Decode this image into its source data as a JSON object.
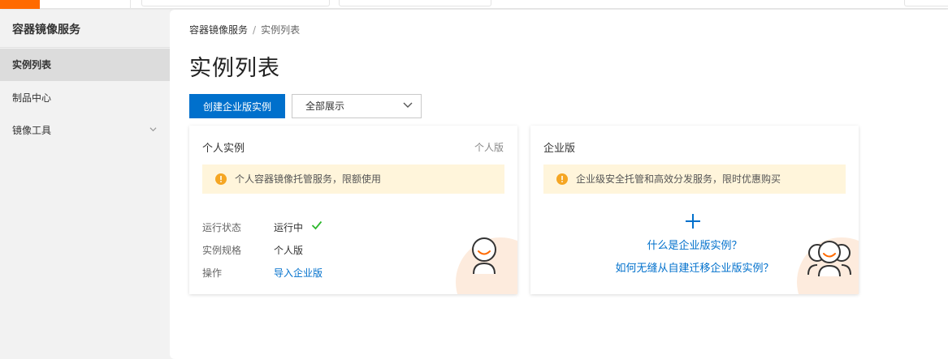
{
  "sidebar": {
    "title": "容器镜像服务",
    "items": [
      {
        "label": "实例列表"
      },
      {
        "label": "制品中心"
      },
      {
        "label": "镜像工具"
      }
    ]
  },
  "breadcrumb": {
    "root": "容器镜像服务",
    "divider": "/",
    "current": "实例列表"
  },
  "page": {
    "title": "实例列表"
  },
  "toolbar": {
    "create_label": "创建企业版实例",
    "filter_value": "全部展示"
  },
  "personal_card": {
    "title": "个人实例",
    "tag": "个人版",
    "notice": "个人容器镜像托管服务，限额使用",
    "rows": [
      {
        "key": "运行状态",
        "value": "运行中"
      },
      {
        "key": "实例规格",
        "value": "个人版"
      },
      {
        "key": "操作",
        "value": "导入企业版"
      }
    ]
  },
  "enterprise_card": {
    "title": "企业版",
    "notice": "企业级安全托管和高效分发服务，限时优惠购买",
    "link1": "什么是企业版实例？",
    "link2": "如何无缝从自建迁移企业版实例？"
  },
  "colors": {
    "accent": "#0070cc",
    "brand": "#ff6a00",
    "warning": "#f5a623",
    "success": "#2eb82e",
    "notice_bg": "#fff5db"
  },
  "icons": {
    "notice": "warning-circle-icon",
    "status": "check-icon",
    "nav_expand": "chevron-down-icon",
    "select_caret": "chevron-down-icon",
    "create": "plus-icon",
    "personal_avatar": "user-avatar-icon",
    "enterprise_avatar": "user-group-icon"
  }
}
